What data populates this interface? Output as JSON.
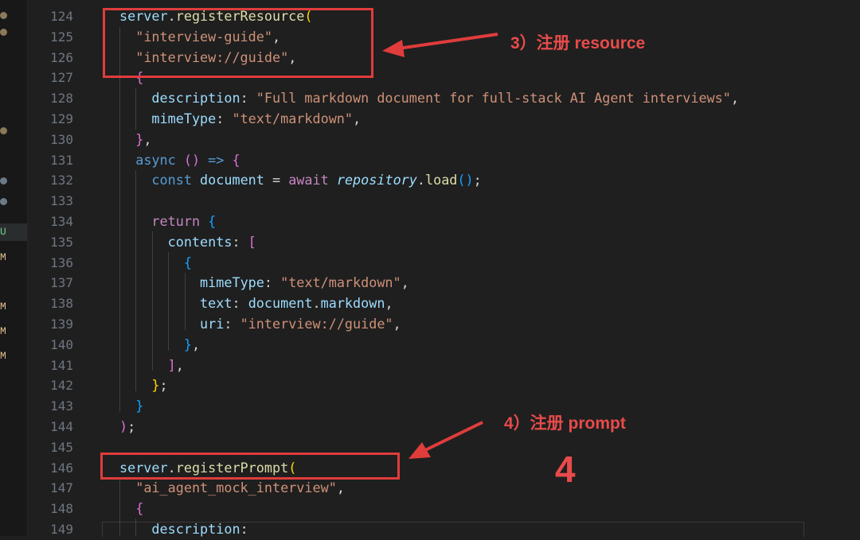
{
  "gutter": {
    "line_numbers": [
      "124",
      "125",
      "126",
      "127",
      "128",
      "129",
      "130",
      "131",
      "132",
      "133",
      "134",
      "135",
      "136",
      "137",
      "138",
      "139",
      "140",
      "141",
      "142",
      "143",
      "144",
      "145",
      "146",
      "147",
      "148",
      "149"
    ]
  },
  "explorer_strip": {
    "letters": [
      "U",
      "M",
      "M",
      "M",
      "M"
    ]
  },
  "code": {
    "l124": {
      "obj": "server",
      "dot": ".",
      "fn": "registerResource",
      "open": "("
    },
    "l125": {
      "str": "\"interview-guide\"",
      "p": ","
    },
    "l126": {
      "str": "\"interview://guide\"",
      "p": ","
    },
    "l127": {
      "b": "{"
    },
    "l128": {
      "key": "description",
      "colon": ": ",
      "str": "\"Full markdown document for full-stack AI Agent interviews\"",
      "p": ","
    },
    "l129": {
      "key": "mimeType",
      "colon": ": ",
      "str": "\"text/markdown\"",
      "p": ","
    },
    "l130": {
      "b": "}",
      "p": ","
    },
    "l131": {
      "kw": "async",
      "sp": " ",
      "b1": "()",
      "arrow": " => ",
      "b2": "{"
    },
    "l132": {
      "kw": "const",
      "id": " document",
      "eq": " = ",
      "kw2": "await",
      "sp": " ",
      "it": "repository",
      "dot": ".",
      "fn": "load",
      "b": "()",
      "semi": ";"
    },
    "l134": {
      "kw": "return",
      "sp": " ",
      "b": "{"
    },
    "l135": {
      "key": "contents",
      "colon": ": ",
      "b": "["
    },
    "l136": {
      "b": "{"
    },
    "l137": {
      "key": "mimeType",
      "colon": ": ",
      "str": "\"text/markdown\"",
      "p": ","
    },
    "l138": {
      "key": "text",
      "colon": ": ",
      "id": "document",
      "dot": ".",
      "prop": "markdown",
      "p": ","
    },
    "l139": {
      "key": "uri",
      "colon": ": ",
      "str": "\"interview://guide\"",
      "p": ","
    },
    "l140": {
      "b": "}",
      "p": ","
    },
    "l141": {
      "b": "]",
      "p": ","
    },
    "l142": {
      "b": "}",
      "semi": ";"
    },
    "l143": {
      "b": "}"
    },
    "l144": {
      "b": ")",
      "semi": ";"
    },
    "l146": {
      "obj": "server",
      "dot": ".",
      "fn": "registerPrompt",
      "open": "("
    },
    "l147": {
      "str": "\"ai_agent_mock_interview\"",
      "p": ","
    },
    "l148": {
      "b": "{"
    },
    "l149": {
      "key": "description",
      "colon": ":"
    }
  },
  "annotations": {
    "resource_label": "3）注册 resource",
    "prompt_label": "4）注册 prompt",
    "big_number": "4"
  },
  "colors": {
    "annotation": "#e03c3c",
    "background": "#1f1f1f"
  }
}
